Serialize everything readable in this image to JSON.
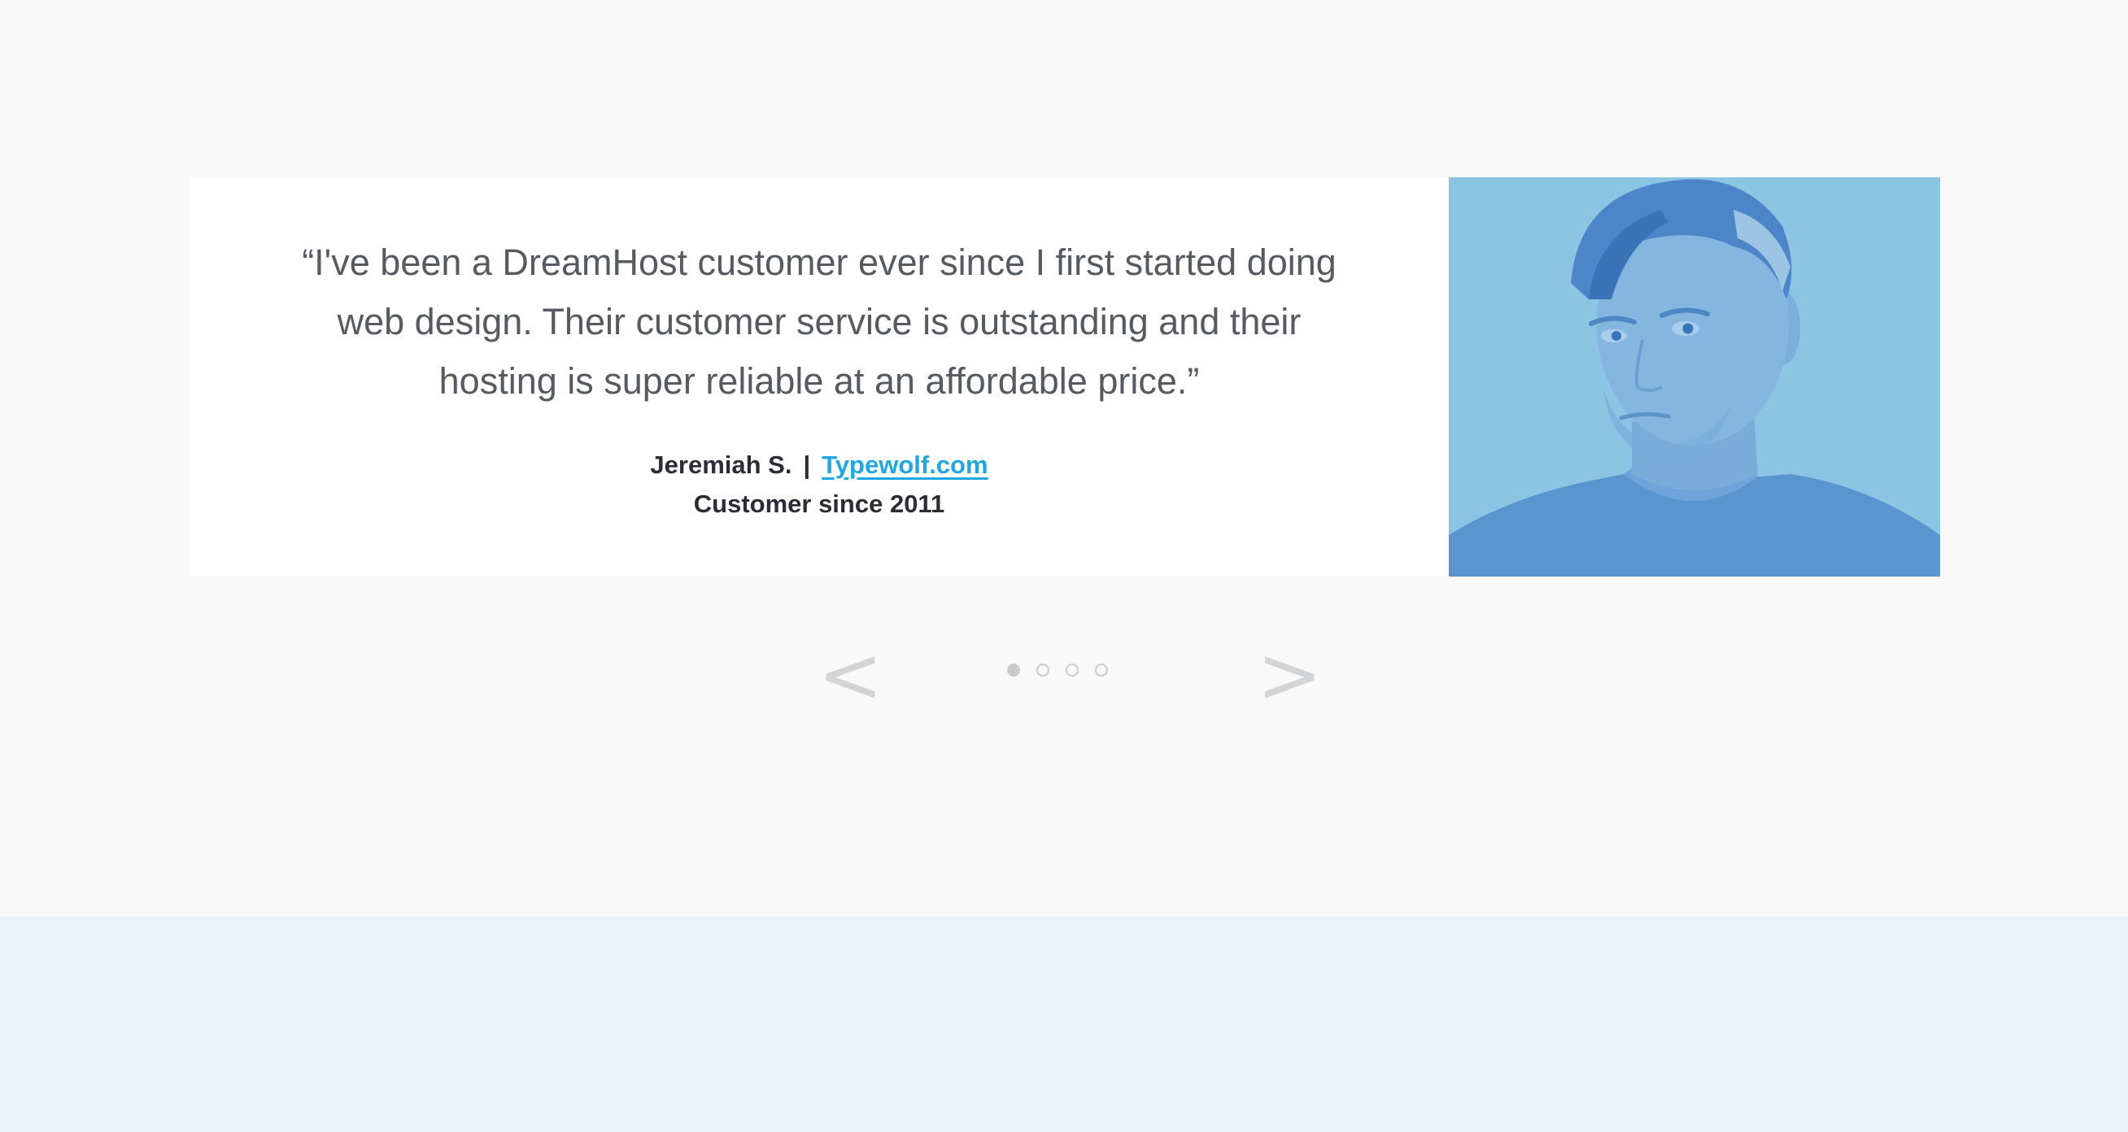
{
  "testimonial": {
    "quote_lines": [
      "“I've been a DreamHost customer ever since I first started doing",
      "web design. Their customer service is outstanding and their",
      "hosting is super reliable at an affordable price.”"
    ],
    "author": "Jeremiah S.",
    "separator": "|",
    "website": "Typewolf.com",
    "customer_since": "Customer since 2011",
    "photo_icon": "customer-portrait"
  },
  "carousel": {
    "prev_label": "<",
    "next_label": ">",
    "slide_count": 4,
    "active_index": 0
  },
  "colors": {
    "quote_text": "#555b60",
    "author_text": "#2a2d34",
    "link": "#1ea7e0",
    "photo_tint": "#8ec3e1",
    "bottom_band": "#edf2f6"
  }
}
